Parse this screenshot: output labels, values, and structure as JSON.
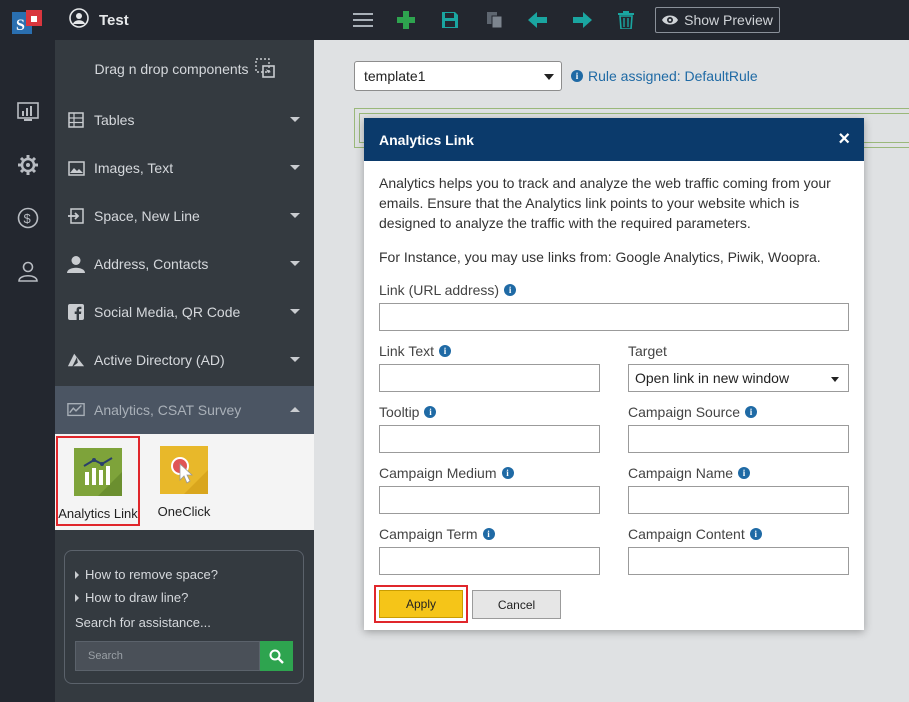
{
  "header": {
    "workspace_name": "Test"
  },
  "toolbar": {
    "preview_label": "Show Preview",
    "icons": [
      "menu-icon",
      "add-icon",
      "save-icon",
      "copy-icon",
      "arrow-left-icon",
      "arrow-right-icon",
      "trash-icon"
    ]
  },
  "sidebar": {
    "drag_label": "Drag n drop components",
    "sections": [
      {
        "label": "Tables",
        "icon": "table-icon"
      },
      {
        "label": "Images, Text",
        "icon": "image-icon"
      },
      {
        "label": "Space, New Line",
        "icon": "enter-icon"
      },
      {
        "label": "Address, Contacts",
        "icon": "person-icon"
      },
      {
        "label": "Social Media, QR Code",
        "icon": "facebook-icon"
      },
      {
        "label": "Active Directory (AD)",
        "icon": "azure-icon"
      },
      {
        "label": "Analytics, CSAT Survey",
        "icon": "analytics-icon"
      }
    ],
    "tiles": [
      {
        "label": "Analytics Link"
      },
      {
        "label": "OneClick"
      }
    ]
  },
  "help": {
    "questions": [
      "How to remove space?",
      "How to draw line?"
    ],
    "search_title": "Search for assistance...",
    "search_placeholder": "Search"
  },
  "workspace": {
    "template_value": "template1",
    "rule_text": "Rule assigned: DefaultRule"
  },
  "modal": {
    "title": "Analytics Link",
    "close": "×",
    "description": "Analytics helps you to track and analyze the web traffic coming from your emails. Ensure that the Analytics link points to your website which is designed to analyze the traffic with the required parameters.",
    "instance_text": "For Instance, you may use links from: Google Analytics, Piwik, Woopra.",
    "fields": {
      "link_url_label": "Link (URL address)",
      "link_text_label": "Link Text",
      "target_label": "Target",
      "target_value": "Open link in new window",
      "tooltip_label": "Tooltip",
      "campaign_source_label": "Campaign Source",
      "campaign_medium_label": "Campaign Medium",
      "campaign_name_label": "Campaign Name",
      "campaign_term_label": "Campaign Term",
      "campaign_content_label": "Campaign Content"
    },
    "apply_label": "Apply",
    "cancel_label": "Cancel"
  },
  "colors": {
    "accent_green": "#2ea44f",
    "teal": "#1aa5a0",
    "header_blue": "#0b3a6b",
    "apply_yellow": "#f5c518",
    "highlight_red": "#e0262b"
  }
}
